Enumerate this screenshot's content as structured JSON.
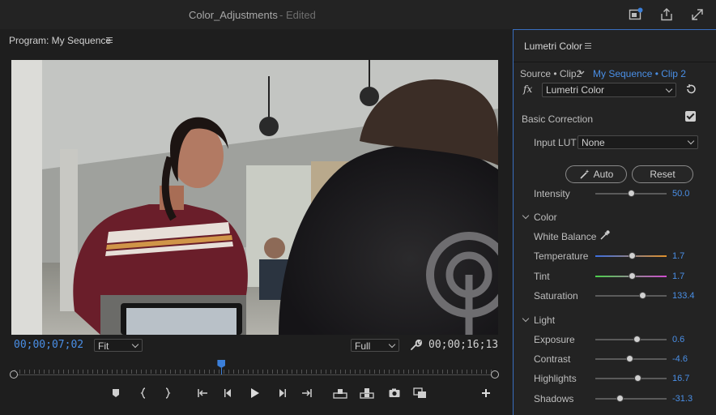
{
  "titlebar": {
    "title": "Color_Adjustments",
    "status": "- Edited",
    "icons": [
      "notification-icon",
      "export-icon",
      "fullscreen-icon"
    ]
  },
  "program": {
    "header": "Program: My Sequence",
    "timecode_current": "00;00;07;02",
    "timecode_duration": "00;00;16;13",
    "zoom": "Fit",
    "resolution": "Full",
    "playhead_fraction": 0.43,
    "transport_icons": [
      "add-marker-icon",
      "mark-in-icon",
      "mark-out-icon",
      "go-to-in-icon",
      "step-back-icon",
      "play-icon",
      "step-forward-icon",
      "go-to-out-icon",
      "lift-icon",
      "extract-icon",
      "export-frame-icon",
      "compare-view-icon",
      "add-button-icon"
    ]
  },
  "lumetri": {
    "title": "Lumetri Color",
    "source": "Source • Clip2",
    "sequence": "My Sequence • Clip 2",
    "effect": "Lumetri Color",
    "basic_correction": "Basic Correction",
    "input_lut_label": "Input LUT",
    "input_lut_value": "None",
    "auto_label": "Auto",
    "reset_label": "Reset",
    "intensity": {
      "label": "Intensity",
      "value": "50.0",
      "fraction": 0.5
    },
    "color_section": "Color",
    "white_balance": "White Balance",
    "temperature": {
      "label": "Temperature",
      "value": "1.7",
      "fraction": 0.52
    },
    "tint": {
      "label": "Tint",
      "value": "1.7",
      "fraction": 0.52
    },
    "saturation": {
      "label": "Saturation",
      "value": "133.4",
      "fraction": 0.66
    },
    "light_section": "Light",
    "exposure": {
      "label": "Exposure",
      "value": "0.6",
      "fraction": 0.58
    },
    "contrast": {
      "label": "Contrast",
      "value": "-4.6",
      "fraction": 0.48
    },
    "highlights": {
      "label": "Highlights",
      "value": "16.7",
      "fraction": 0.6
    },
    "shadows": {
      "label": "Shadows",
      "value": "-31.3",
      "fraction": 0.35
    },
    "colors": {
      "accent": "#4a8fe6",
      "temperature_left": "#3c6ee0",
      "temperature_right": "#e0902a",
      "tint_left": "#4bd04b",
      "tint_right": "#d04bd0"
    }
  }
}
